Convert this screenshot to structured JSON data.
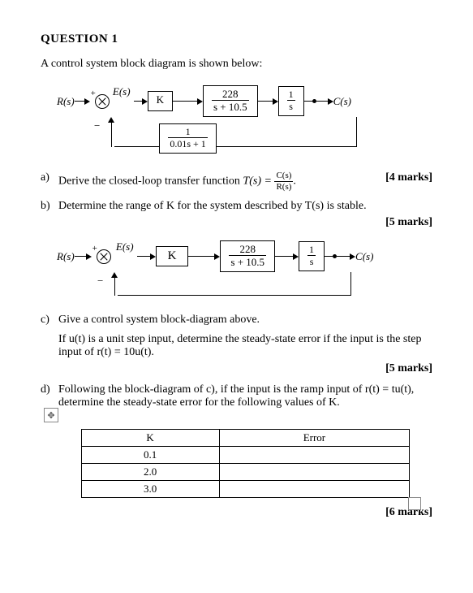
{
  "title": "QUESTION 1",
  "intro": "A control system block diagram is shown below:",
  "diagram1": {
    "R": "R(s)",
    "plus": "+",
    "minus": "−",
    "E": "E(s)",
    "K": "K",
    "g1_num": "228",
    "g1_den": "s + 10.5",
    "int_num": "1",
    "int_den": "s",
    "C": "C(s)",
    "fb_num": "1",
    "fb_den": "0.01s + 1"
  },
  "parts": {
    "a": {
      "label": "a)",
      "text_pre": "Derive the closed-loop transfer function ",
      "T": "T(s) =",
      "frac_num": "C(s)",
      "frac_den": "R(s)",
      "text_post": ".",
      "marks": "[4 marks]"
    },
    "b": {
      "label": "b)",
      "text": "Determine the range of K for the system described by T(s) is stable.",
      "marks": "[5 marks]"
    },
    "c": {
      "label": "c)",
      "line1": "Give a control system block-diagram above.",
      "line2": "If u(t) is a unit step input, determine the steady-state error if the input is the step input of r(t) = 10u(t).",
      "marks": "[5 marks]"
    },
    "d": {
      "label": "d)",
      "text": "Following the block-diagram of c), if the input is the ramp input of r(t) = tu(t), determine the steady-state error for the following values of K.",
      "table": {
        "head_K": "K",
        "head_E": "Error",
        "rows": [
          "0.1",
          "2.0",
          "3.0"
        ]
      },
      "marks": "[6 marks]"
    }
  },
  "diagram2": {
    "R": "R(s)",
    "plus": "+",
    "minus": "−",
    "E": "E(s)",
    "K": "K",
    "g1_num": "228",
    "g1_den": "s + 10.5",
    "int_num": "1",
    "int_den": "s",
    "C": "C(s)"
  }
}
